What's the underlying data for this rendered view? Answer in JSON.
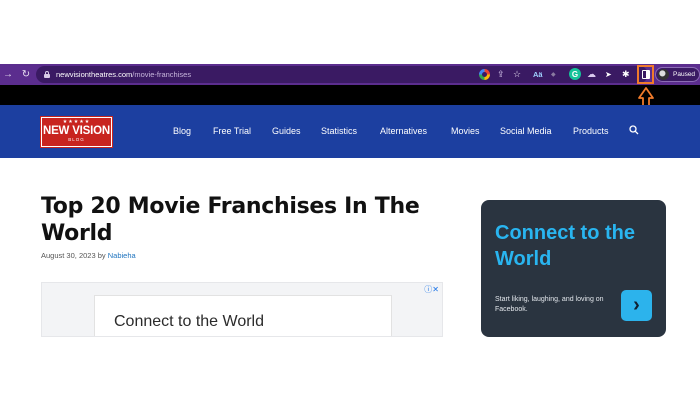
{
  "browser": {
    "url_host": "newvisiontheatres.com",
    "url_path": "/movie-franchises",
    "profile_status": "Paused",
    "aa_extension": "Aä",
    "accent_color": "#f07b2b",
    "icons": [
      "back-icon",
      "reload-icon",
      "lock-icon",
      "google-icon",
      "share-icon",
      "star-icon",
      "translate-icon",
      "grammarly-icon",
      "read-aloud-icon",
      "cursor-icon",
      "puzzle-icon",
      "side-panel-icon",
      "avatar"
    ]
  },
  "site": {
    "logo": {
      "stars": "★★★★★",
      "brand": "NEW VISION",
      "sub": "BLOG"
    },
    "nav": [
      "Blog",
      "Free Trial",
      "Guides",
      "Statistics",
      "Alternatives",
      "Movies",
      "Social Media",
      "Products"
    ],
    "brand_color": "#1c3fa0"
  },
  "article": {
    "title": "Top 20 Movie Franchises In The World",
    "date": "August 30, 2023",
    "by": "by",
    "author": "Nabieha"
  },
  "ad": {
    "choices_icon": "ⓘ✕",
    "text": "Connect to the World"
  },
  "promo": {
    "title": "Connect to the World",
    "text": "Start liking, laughing, and loving on Facebook.",
    "button": "›"
  }
}
